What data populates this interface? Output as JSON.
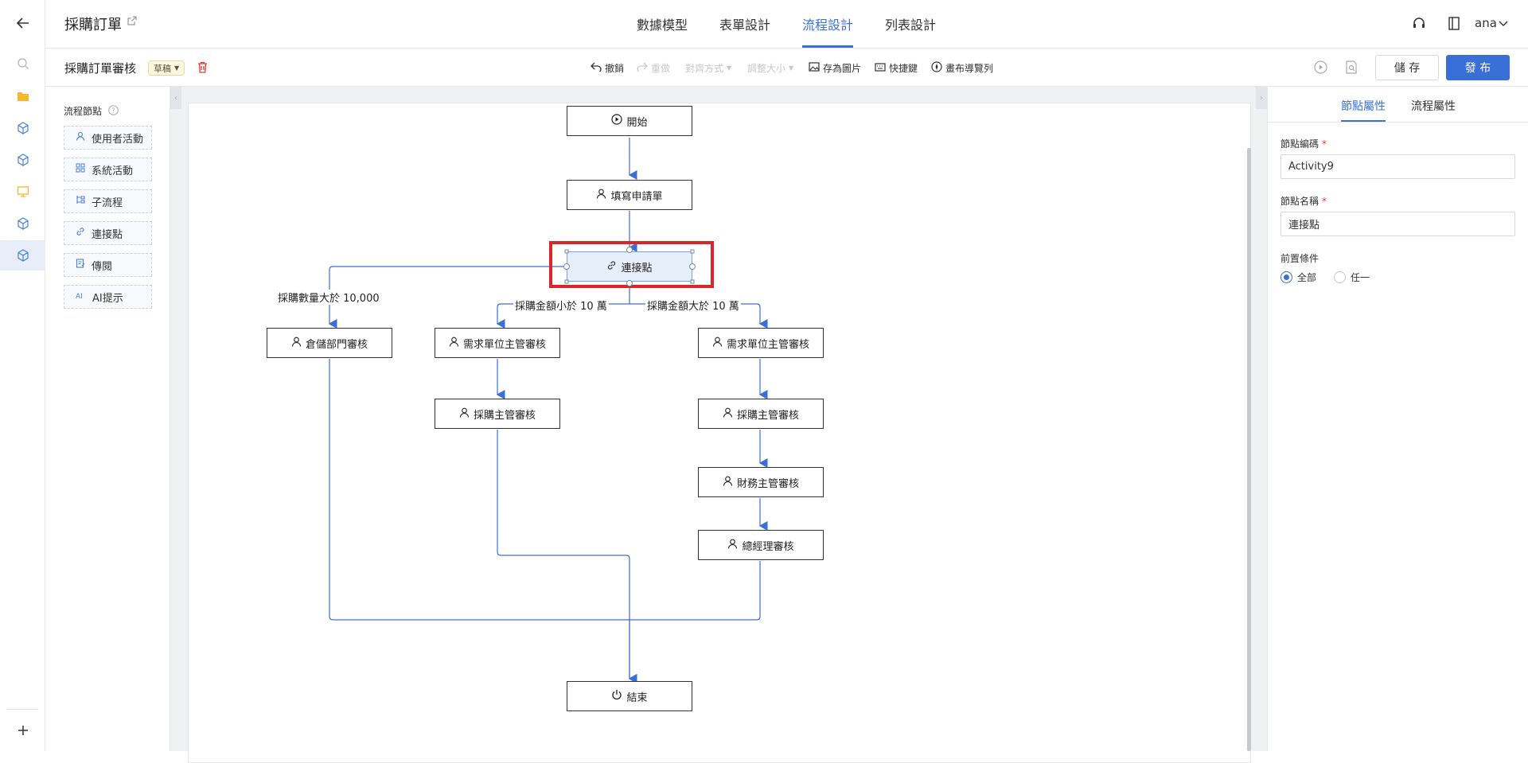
{
  "app": {
    "title": "採購訂單",
    "user": "ana"
  },
  "top_tabs": [
    {
      "label": "數據模型",
      "active": false
    },
    {
      "label": "表單設計",
      "active": false
    },
    {
      "label": "流程設計",
      "active": true
    },
    {
      "label": "列表設計",
      "active": false
    }
  ],
  "toolbar": {
    "workflow_name": "採購訂單審核",
    "status": "草稿",
    "undo": "撤銷",
    "redo": "重做",
    "align": "對齊方式",
    "resize": "調整大小",
    "save_image": "存為圖片",
    "shortcuts": "快捷鍵",
    "canvas_nav": "畫布導覽列",
    "save_label": "儲 存",
    "publish_label": "發 布"
  },
  "palette": {
    "title": "流程節點",
    "items": [
      {
        "label": "使用者活動",
        "icon": "user-icon"
      },
      {
        "label": "系統活動",
        "icon": "grid-icon"
      },
      {
        "label": "子流程",
        "icon": "subflow-icon"
      },
      {
        "label": "連接點",
        "icon": "link-icon"
      },
      {
        "label": "傳閱",
        "icon": "circulate-icon"
      },
      {
        "label": "AI提示",
        "icon": "ai-icon"
      }
    ]
  },
  "flow": {
    "start": "開始",
    "fill": "填寫申請單",
    "connector": "連接點",
    "warehouse": "倉儲部門審核",
    "dept_left": "需求單位主管審核",
    "purch_left": "採購主管審核",
    "dept_right": "需求單位主管審核",
    "purch_right": "採購主管審核",
    "finance": "財務主管審核",
    "gm": "總經理審核",
    "end": "結束",
    "label_qty": "採購數量大於 10,000",
    "label_lt": "採購金額小於 10 萬",
    "label_gt": "採購金額大於 10 萬"
  },
  "right_panel": {
    "tabs": [
      {
        "label": "節點屬性",
        "active": true
      },
      {
        "label": "流程屬性",
        "active": false
      }
    ],
    "code_label": "節點編碼",
    "code_value": "Activity9",
    "name_label": "節點名稱",
    "name_value": "連接點",
    "precondition_label": "前置條件",
    "options": [
      {
        "label": "全部",
        "checked": true
      },
      {
        "label": "任一",
        "checked": false
      }
    ]
  },
  "colors": {
    "accent": "#3a6fd8",
    "highlight": "#d9252b",
    "edge": "#3a6fd8"
  }
}
